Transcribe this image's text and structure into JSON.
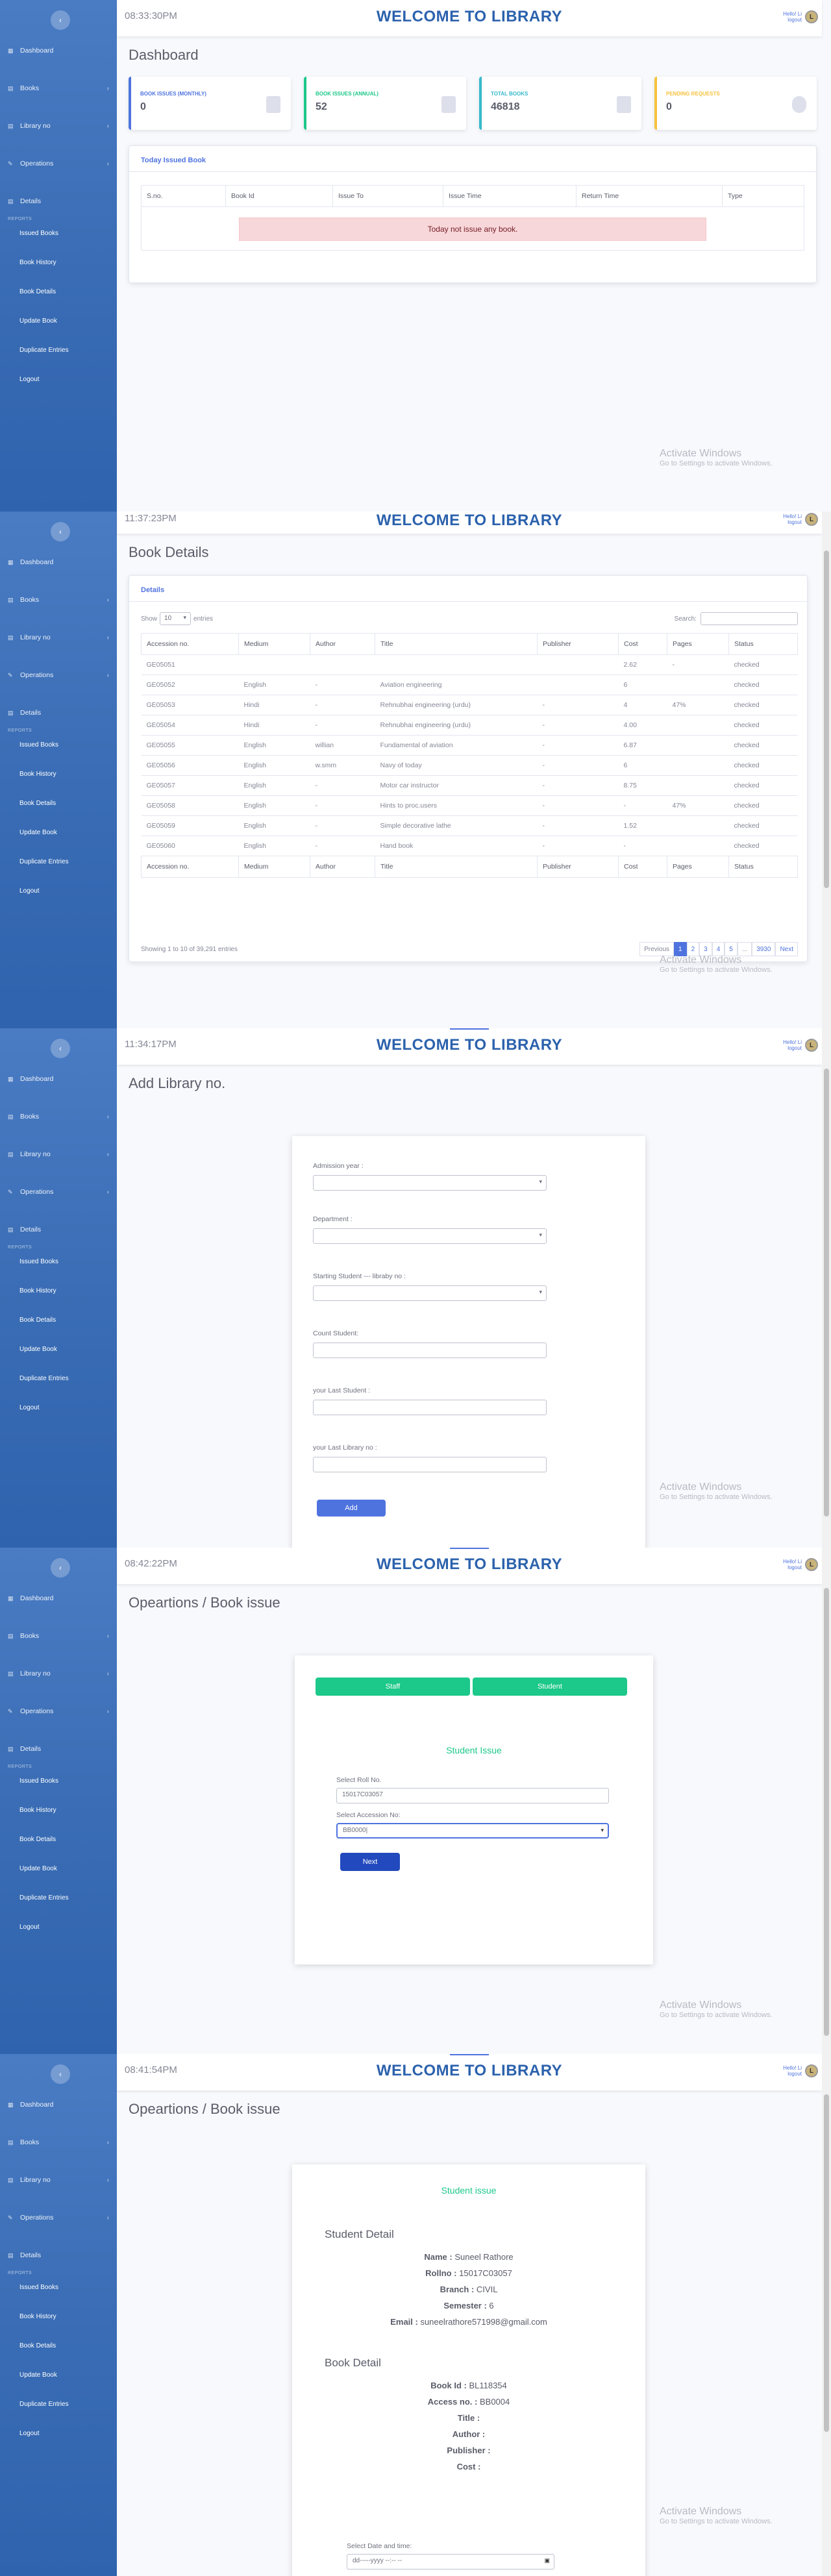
{
  "sidebar": {
    "toggle_icon": "‹",
    "items": [
      {
        "label": "Dashboard",
        "icon": "▦"
      },
      {
        "label": "Books",
        "icon": "▤",
        "chev": "›"
      },
      {
        "label": "Library no",
        "icon": "▤",
        "chev": "›"
      },
      {
        "label": "Operations",
        "icon": "✎",
        "chev": "›"
      },
      {
        "label": "Details",
        "icon": "▤"
      }
    ],
    "heading": "REPORTS",
    "subitems": [
      "Issued Books",
      "Book History",
      "Book Details",
      "Update Book",
      "Duplicate Entries",
      "Logout"
    ]
  },
  "header": {
    "title": "WELCOME TO LIBRARY",
    "user_line1": "Hello! Li",
    "user_line2": "logout",
    "avatar": "L"
  },
  "watermark": {
    "line1": "Activate Windows",
    "line2": "Go to Settings to activate Windows."
  },
  "screen1": {
    "time": "08:33:30PM",
    "page_title": "Dashboard",
    "stats": [
      {
        "label": "BOOK ISSUES (MONTHLY)",
        "value": "0",
        "color": "#4e73df"
      },
      {
        "label": "BOOK ISSUES (ANNUAL)",
        "value": "52",
        "color": "#1cc88a"
      },
      {
        "label": "TOTAL BOOKS",
        "value": "46818",
        "color": "#36b9cc"
      },
      {
        "label": "PENDING REQUESTS",
        "value": "0",
        "color": "#f6c23e"
      }
    ],
    "card_title": "Today Issued Book",
    "columns": [
      "S.no.",
      "Book Id",
      "Issue To",
      "Issue Time",
      "Return Time",
      "Type"
    ],
    "empty_msg": "Today not issue any book."
  },
  "screen2": {
    "time": "11:37:23PM",
    "page_title": "Book Details",
    "card_title": "Details",
    "show": "Show",
    "entries_val": "10",
    "entries": "entries",
    "search": "Search:",
    "columns": [
      "Accession no.",
      "Medium",
      "Author",
      "Title",
      "Publisher",
      "Cost",
      "Pages",
      "Status"
    ],
    "rows": [
      [
        "GE05051",
        "",
        "",
        "",
        "",
        "2.62",
        "-",
        "checked"
      ],
      [
        "GE05052",
        "English",
        "-",
        "Aviation engineering",
        "",
        "6",
        "",
        "checked"
      ],
      [
        "GE05053",
        "Hindi",
        "-",
        "Rehnubhai engineering (urdu)",
        "-",
        "4",
        "47%",
        "checked"
      ],
      [
        "GE05054",
        "Hindi",
        "-",
        "Rehnubhai engineering (urdu)",
        "-",
        "4.00",
        "",
        "checked"
      ],
      [
        "GE05055",
        "English",
        "willian",
        "Fundamental of aviation",
        "-",
        "6.87",
        "",
        "checked"
      ],
      [
        "GE05056",
        "English",
        "w.smm",
        "Navy of today",
        "-",
        "6",
        "",
        "checked"
      ],
      [
        "GE05057",
        "English",
        "-",
        "Motor car instructor",
        "-",
        "8.75",
        "",
        "checked"
      ],
      [
        "GE05058",
        "English",
        "-",
        "Hints to proc.users",
        "-",
        "-",
        "47%",
        "checked"
      ],
      [
        "GE05059",
        "English",
        "-",
        "Simple decorative lathe",
        "-",
        "1.52",
        "",
        "checked"
      ],
      [
        "GE05060",
        "English",
        "-",
        "Hand book",
        "-",
        "-",
        "",
        "checked"
      ]
    ],
    "info": "Showing 1 to 10 of 39,291 entries",
    "pagination": [
      "Previous",
      "1",
      "2",
      "3",
      "4",
      "5",
      "...",
      "3930",
      "Next"
    ]
  },
  "screen3": {
    "time": "11:34:17PM",
    "page_title": "Add Library no.",
    "fields": [
      {
        "label": "Admission year :",
        "type": "select"
      },
      {
        "label": "Department :",
        "type": "select"
      },
      {
        "label": "Starting Student --- libraby no :",
        "type": "select"
      },
      {
        "label": "Count Student:",
        "type": "input"
      },
      {
        "label": "your Last Student :",
        "type": "input"
      },
      {
        "label": "your Last Library no :",
        "type": "input"
      }
    ],
    "add_label": "Add"
  },
  "screen4": {
    "time": "08:42:22PM",
    "page_title": "Opeartions / Book issue",
    "staff_label": "Staff",
    "student_label": "Student",
    "section_title": "Student Issue",
    "roll_label": "Select Roll No.",
    "roll_value": "15017C03057",
    "acc_label": "Select Accession No:",
    "acc_value": "BB0000|",
    "next_label": "Next"
  },
  "screen5": {
    "time": "08:41:54PM",
    "page_title": "Opeartions / Book issue",
    "section_title": "Student issue",
    "student_heading": "Student Detail",
    "student": [
      {
        "k": "Name :",
        "v": " Suneel Rathore"
      },
      {
        "k": "Rollno :",
        "v": " 15017C03057"
      },
      {
        "k": "Branch :",
        "v": " CIVIL"
      },
      {
        "k": "Semester :",
        "v": " 6"
      },
      {
        "k": "Email :",
        "v": " suneelrathore571998@gmail.com"
      }
    ],
    "book_heading": "Book Detail",
    "book": [
      {
        "k": "Book Id :",
        "v": " BL118354"
      },
      {
        "k": "Access no. :",
        "v": " BB0004"
      },
      {
        "k": "Title :",
        "v": ""
      },
      {
        "k": "Author :",
        "v": ""
      },
      {
        "k": "Publisher :",
        "v": ""
      },
      {
        "k": "Cost :",
        "v": ""
      }
    ],
    "date_label": "Select Date and time:",
    "date_placeholder": "dd-----yyyy  --:-- --"
  }
}
